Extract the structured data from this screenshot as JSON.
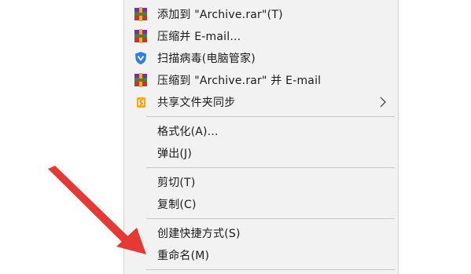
{
  "menu": {
    "items": [
      {
        "label": "添加到 \"Archive.rar\"(T)",
        "icon": "winrar-archive-icon"
      },
      {
        "label": "压缩并 E-mail...",
        "icon": "winrar-archive-icon"
      },
      {
        "label": "扫描病毒(电脑管家)",
        "icon": "tencent-pc-manager-shield-icon"
      },
      {
        "label": "压缩到 \"Archive.rar\" 并 E-mail",
        "icon": "winrar-archive-icon"
      },
      {
        "label": "共享文件夹同步",
        "icon": "folder-sync-icon",
        "has_submenu": true
      },
      {
        "label": "格式化(A)..."
      },
      {
        "label": "弹出(J)"
      },
      {
        "label": "剪切(T)"
      },
      {
        "label": "复制(C)"
      },
      {
        "label": "创建快捷方式(S)"
      },
      {
        "label": "重命名(M)"
      }
    ]
  },
  "annotation": {
    "arrow_color": "#e53935"
  },
  "colors": {
    "menu_background": "#f2f2f2",
    "separator": "#c8c8c8",
    "shield_blue": "#2f7de1"
  }
}
